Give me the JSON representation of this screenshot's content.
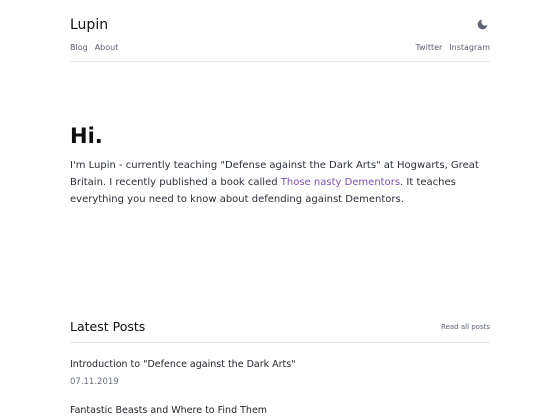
{
  "header": {
    "site_title": "Lupin",
    "theme_icon": "moon-icon",
    "nav_left": [
      "Blog",
      "About"
    ],
    "nav_right": [
      "Twitter",
      "Instagram"
    ]
  },
  "hero": {
    "title": "Hi.",
    "bio_part1": "I'm Lupin - currently teaching \"Defense against the Dark Arts\" at Hogwarts, Great Britain. I recently published a book called ",
    "bio_link": "Those nasty Dementors",
    "bio_part2": ". It teaches everything you need to know about defending against Dementors."
  },
  "posts": {
    "section_title": "Latest Posts",
    "read_all_label": "Read all posts",
    "items": [
      {
        "title": "Introduction to \"Defence against the Dark Arts\"",
        "date": "07.11.2019"
      },
      {
        "title": "Fantastic Beasts and Where to Find Them",
        "date": ""
      }
    ]
  },
  "colors": {
    "link_accent": "#7b4fb6",
    "text": "#2b2f38",
    "muted": "#5a6070",
    "divider": "#e6e7ea"
  }
}
